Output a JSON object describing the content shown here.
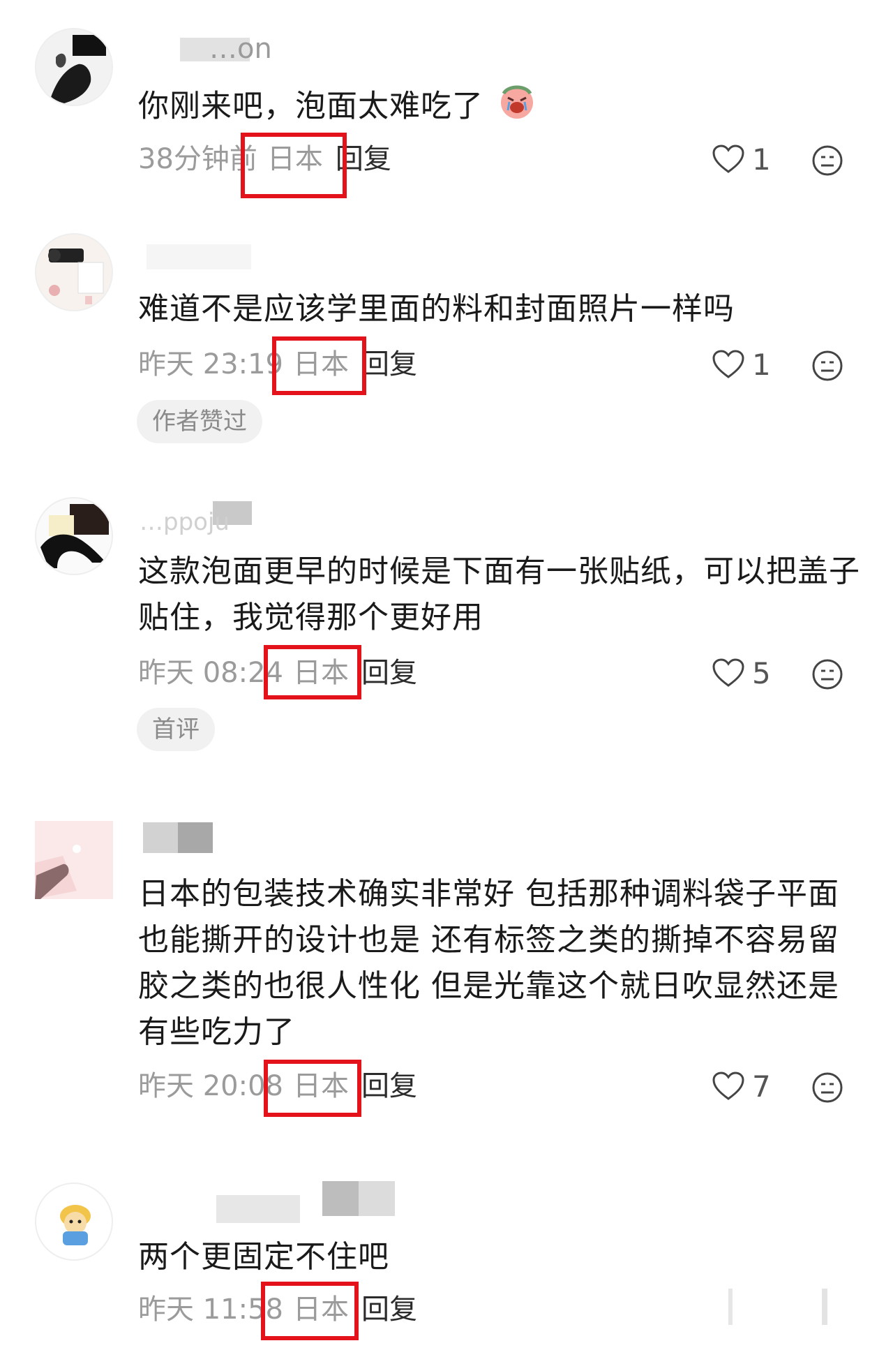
{
  "comments": [
    {
      "username": "…on",
      "text": "你刚来吧，泡面太难吃了",
      "time": "38分钟前",
      "location": "日本",
      "reply": "回复",
      "likes": "1",
      "emoji": "crying-face-emoji"
    },
    {
      "username": "",
      "text": "难道不是应该学里面的料和封面照片一样吗",
      "time": "昨天 23:19",
      "location": "日本",
      "reply": "回复",
      "likes": "1",
      "badge": "作者赞过"
    },
    {
      "username": "…ppoju",
      "text": "这款泡面更早的时候是下面有一张贴纸，可以把盖子贴住，我觉得那个更好用",
      "time": "昨天 08:24",
      "location": "日本",
      "reply": "回复",
      "likes": "5",
      "badge": "首评"
    },
    {
      "username": "",
      "text": "日本的包装技术确实非常好 包括那种调料袋子平面也能撕开的设计也是 还有标签之类的撕掉不容易留胶之类的也很人性化 但是光靠这个就日吹显然还是有些吃力了",
      "time": "昨天 20:08",
      "location": "日本",
      "reply": "回复",
      "likes": "7"
    },
    {
      "username": "",
      "text": "两个更固定不住吧",
      "time": "昨天 11:58",
      "location": "日本",
      "reply": "回复",
      "likes": ""
    }
  ],
  "colors": {
    "highlight": "#e4131b",
    "meta_text": "#9b9b9b",
    "body_text": "#1a1a1a"
  }
}
